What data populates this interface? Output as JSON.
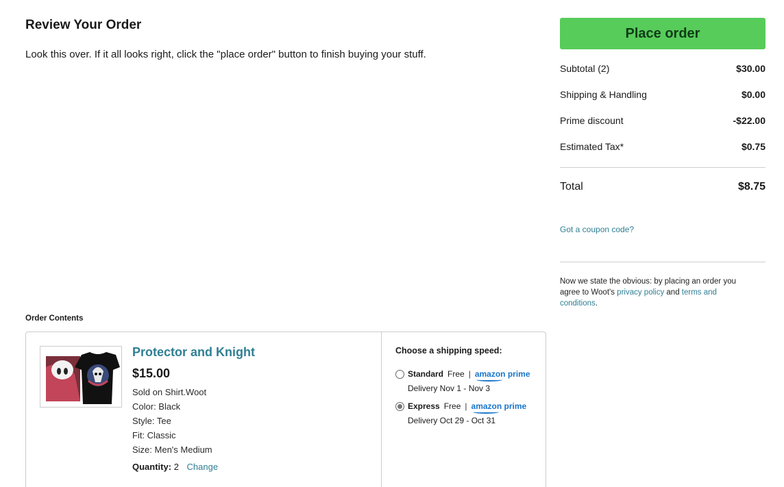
{
  "page": {
    "title": "Review Your Order",
    "intro": "Look this over. If it all looks right, click the \"place order\" button to finish buying your stuff."
  },
  "order_contents": {
    "label": "Order Contents",
    "item": {
      "name": "Protector and Knight",
      "price": "$15.00",
      "attributes": [
        "Sold on Shirt.Woot",
        "Color: Black",
        "Style: Tee",
        "Fit: Classic",
        "Size: Men's Medium"
      ],
      "quantity_label": "Quantity:",
      "quantity_value": "2",
      "change_label": "Change",
      "image_icon": "tshirt-product-image"
    },
    "shipping": {
      "heading": "Choose a shipping speed:",
      "options": [
        {
          "name": "Standard",
          "cost": "Free",
          "separator": "|",
          "badge": "amazon prime",
          "delivery": "Delivery Nov 1 - Nov 3",
          "selected": false
        },
        {
          "name": "Express",
          "cost": "Free",
          "separator": "|",
          "badge": "amazon prime",
          "delivery": "Delivery Oct 29 - Oct 31",
          "selected": true
        }
      ]
    }
  },
  "summary": {
    "place_order_label": "Place order",
    "rows": [
      {
        "label": "Subtotal (2)",
        "value": "$30.00"
      },
      {
        "label": "Shipping & Handling",
        "value": "$0.00"
      },
      {
        "label": "Prime discount",
        "value": "-$22.00"
      },
      {
        "label": "Estimated Tax*",
        "value": "$0.75"
      }
    ],
    "total_label": "Total",
    "total_value": "$8.75",
    "coupon_label": "Got a coupon code?",
    "legal": {
      "prefix": "Now we state the obvious: by placing an order you agree to Woot's ",
      "privacy_link": "privacy policy",
      "middle": " and ",
      "terms_link": "terms and conditions",
      "suffix": "."
    }
  },
  "colors": {
    "accent_green": "#57cc5a",
    "link_teal": "#2f7f93",
    "prime_blue": "#1a75c9"
  }
}
